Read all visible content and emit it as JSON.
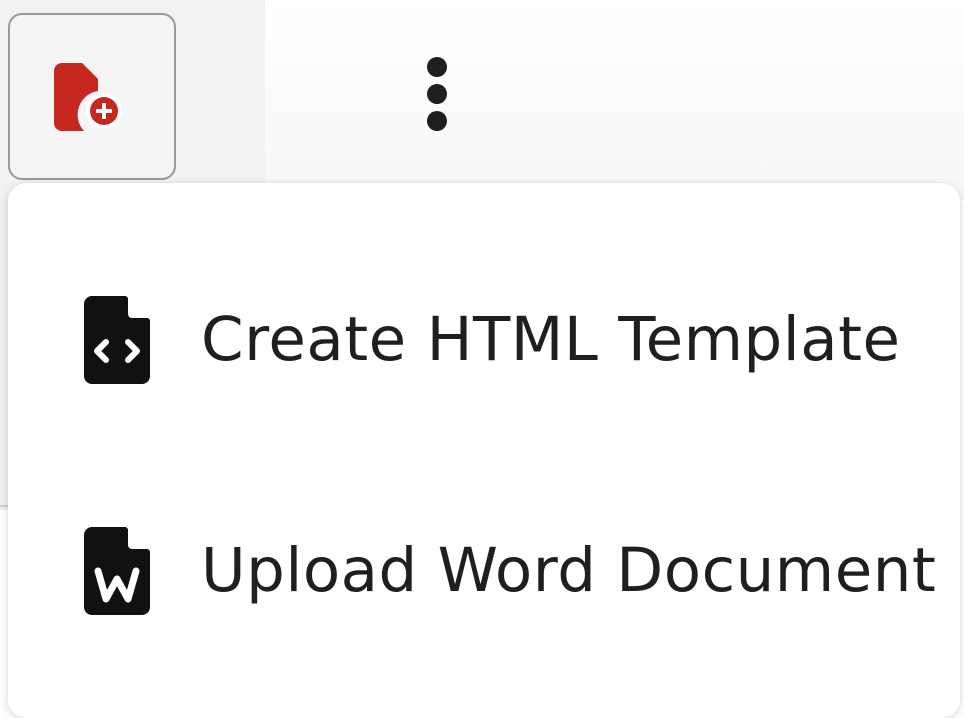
{
  "toolbar": {
    "new_document_button": {
      "icon": "file-add-icon",
      "accent_color": "#c5281f"
    },
    "more_options_button": {
      "icon": "kebab-menu-icon"
    }
  },
  "menu": {
    "items": [
      {
        "label": "Create HTML Template",
        "icon": "file-code-icon"
      },
      {
        "label": "Upload Word Document",
        "icon": "file-word-icon"
      }
    ]
  }
}
